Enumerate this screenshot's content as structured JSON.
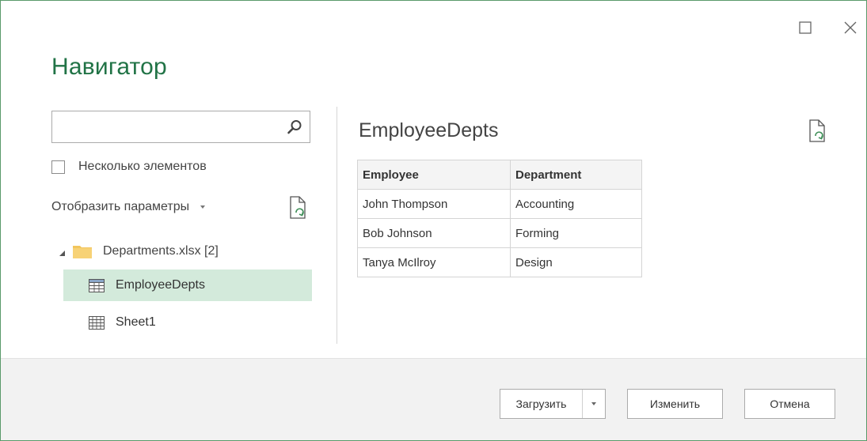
{
  "window": {
    "title": "Навигатор"
  },
  "left_pane": {
    "search": {
      "value": "",
      "placeholder": ""
    },
    "multiple_items_label": "Несколько элементов",
    "multiple_items_checked": false,
    "display_options_label": "Отобразить параметры",
    "tree": {
      "folder": {
        "label": "Departments.xlsx [2]",
        "expanded": true
      },
      "items": [
        {
          "label": "EmployeeDepts",
          "icon": "table-icon",
          "selected": true
        },
        {
          "label": "Sheet1",
          "icon": "sheet-icon",
          "selected": false
        }
      ]
    }
  },
  "right_pane": {
    "title": "EmployeeDepts",
    "table": {
      "headers": [
        "Employee",
        "Department"
      ],
      "rows": [
        [
          "John Thompson",
          "Accounting"
        ],
        [
          "Bob Johnson",
          "Forming"
        ],
        [
          "Tanya McIlroy",
          "Design"
        ]
      ]
    }
  },
  "footer": {
    "load_label": "Загрузить",
    "edit_label": "Изменить",
    "cancel_label": "Отмена"
  },
  "colors": {
    "accent": "#217346",
    "selection": "#d3eadb",
    "footer_bg": "#f2f2f2"
  }
}
